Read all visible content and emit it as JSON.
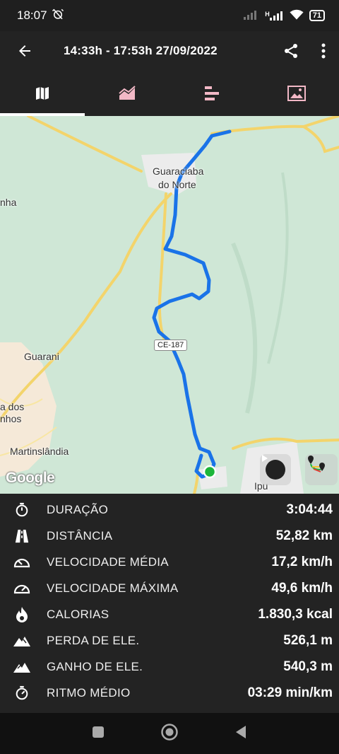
{
  "status_bar": {
    "time": "18:07",
    "network_label": "H",
    "battery": "71"
  },
  "app_bar": {
    "title": "14:33h - 17:53h  27/09/2022"
  },
  "tabs": [
    {
      "id": "map",
      "icon": "map-icon",
      "active": true
    },
    {
      "id": "chart",
      "icon": "area-chart-icon",
      "active": false
    },
    {
      "id": "laps",
      "icon": "bars-icon",
      "active": false
    },
    {
      "id": "photos",
      "icon": "image-icon",
      "active": false
    }
  ],
  "map": {
    "labels": {
      "guaraciaba_1": "Guaraciaba",
      "guaraciaba_2": "do Norte",
      "nha": "nha",
      "guarani": "Guarani",
      "dos_1": "a dos",
      "dos_2": "nhos",
      "martinslandia": "Martinslândia",
      "ipu": "Ipu"
    },
    "road_shield": "CE-187",
    "attribution": "Google",
    "route_color": "#1a73e8",
    "start_marker_color": "#1db53a"
  },
  "stats": [
    {
      "icon": "stopwatch-icon",
      "label": "DURAÇÃO",
      "value": "3:04:44"
    },
    {
      "icon": "road-icon",
      "label": "DISTÂNCIA",
      "value": "52,82 km"
    },
    {
      "icon": "speedometer-icon",
      "label": "VELOCIDADE MÉDIA",
      "value": "17,2 km/h"
    },
    {
      "icon": "speedometer-max-icon",
      "label": "VELOCIDADE MÁXIMA",
      "value": "49,6 km/h"
    },
    {
      "icon": "flame-icon",
      "label": "CALORIAS",
      "value": "1.830,3 kcal"
    },
    {
      "icon": "mountain-down-icon",
      "label": "PERDA DE ELE.",
      "value": "526,1 m"
    },
    {
      "icon": "mountain-up-icon",
      "label": "GANHO DE ELE.",
      "value": "540,3 m"
    },
    {
      "icon": "pace-icon",
      "label": "RITMO MÉDIO",
      "value": "03:29 min/km"
    }
  ],
  "colors": {
    "background": "#232323",
    "accent": "#ffffff",
    "map_bg": "#cfe7d6"
  }
}
